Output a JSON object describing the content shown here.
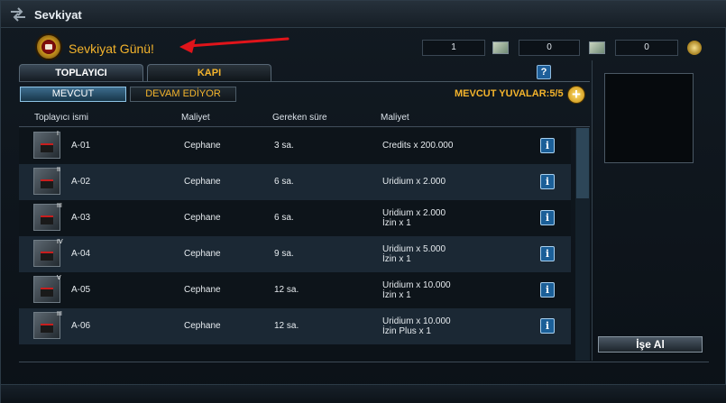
{
  "window": {
    "title": "Sevkiyat"
  },
  "header": {
    "event_title": "Sevkiyat Günü!",
    "resources": [
      "1",
      "0",
      "0"
    ]
  },
  "tabs": [
    {
      "label": "TOPLAYICI",
      "active": true
    },
    {
      "label": "KAPI",
      "active": false
    }
  ],
  "subtabs": [
    {
      "label": "MEVCUT",
      "active": true
    },
    {
      "label": "DEVAM EDİYOR",
      "active": false
    }
  ],
  "slots_label": "MEVCUT YUVALAR:5/5",
  "columns": [
    "Toplayıcı ismi",
    "Maliyet",
    "Gereken süre",
    "Maliyet"
  ],
  "rows": [
    {
      "rank": "I",
      "name": "A-01",
      "cost": "Cephane",
      "time": "3 sa.",
      "price": [
        "Credits x 200.000"
      ]
    },
    {
      "rank": "II",
      "name": "A-02",
      "cost": "Cephane",
      "time": "6 sa.",
      "price": [
        "Uridium x 2.000"
      ]
    },
    {
      "rank": "III",
      "name": "A-03",
      "cost": "Cephane",
      "time": "6 sa.",
      "price": [
        "Uridium x 2.000",
        "İzin x 1"
      ]
    },
    {
      "rank": "IV",
      "name": "A-04",
      "cost": "Cephane",
      "time": "9 sa.",
      "price": [
        "Uridium x 5.000",
        "İzin x 1"
      ]
    },
    {
      "rank": "V",
      "name": "A-05",
      "cost": "Cephane",
      "time": "12 sa.",
      "price": [
        "Uridium x 10.000",
        "İzin x 1"
      ]
    },
    {
      "rank": "III",
      "name": "A-06",
      "cost": "Cephane",
      "time": "12 sa.",
      "price": [
        "Uridium x 10.000",
        "İzin Plus x 1"
      ]
    }
  ],
  "collect_button": "İşe Al",
  "colors": {
    "accent": "#f4b42c",
    "panel": "#121a22",
    "row_even": "#1b2834",
    "row_odd": "#0d141a",
    "info_blue": "#1b5f98"
  }
}
